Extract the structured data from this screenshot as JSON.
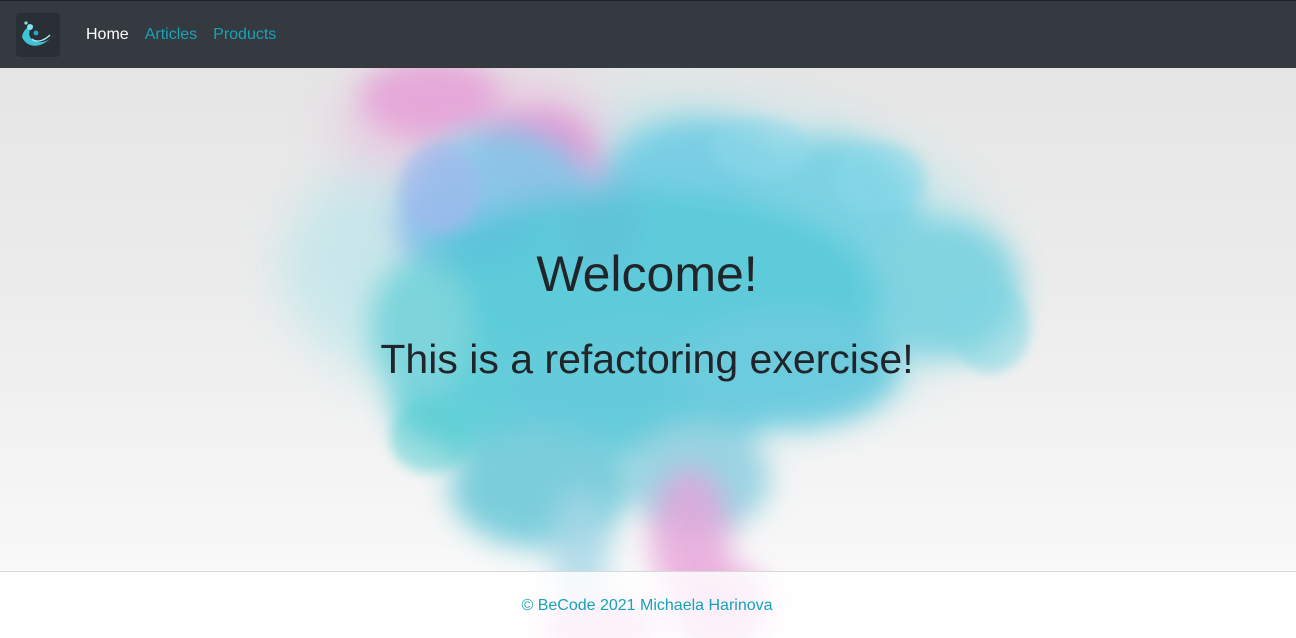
{
  "navbar": {
    "logo_icon": "splash-logo-icon",
    "links": [
      {
        "label": "Home",
        "active": true
      },
      {
        "label": "Articles",
        "active": false
      },
      {
        "label": "Products",
        "active": false
      }
    ]
  },
  "hero": {
    "title": "Welcome!",
    "subtitle": "This is a refactoring exercise!"
  },
  "footer": {
    "text": "© BeCode 2021 Michaela Harinova"
  },
  "colors": {
    "navbar_bg": "#343a40",
    "link": "#17a2b8",
    "active_link": "#ffffff",
    "text": "#212529",
    "ink_cyan": "#4cc7d8",
    "ink_pink": "#e59ad6"
  }
}
